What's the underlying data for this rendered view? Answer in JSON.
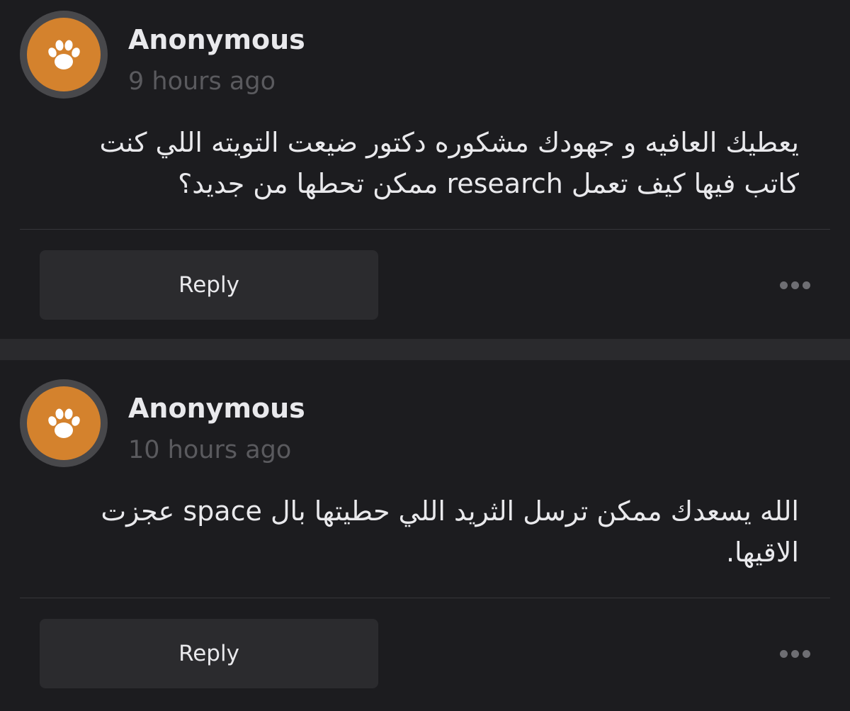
{
  "comments": [
    {
      "author": "Anonymous",
      "time": "9 hours ago",
      "message_lines": [
        "يعطيك العافيه و جهودك مشكوره دكتور ضيعت التويته اللي كنت",
        "كاتب فيها كيف تعمل research ممكن تحطها من جديد؟"
      ],
      "reply_label": "Reply",
      "avatar_icon": "paw-icon",
      "more_icon": "ellipsis-icon"
    },
    {
      "author": "Anonymous",
      "time": "10 hours ago",
      "message_lines": [
        "الله يسعدك ممكن ترسل الثريد اللي حطيتها بال space  عجزت",
        "الاقيها."
      ],
      "reply_label": "Reply",
      "avatar_icon": "paw-icon",
      "more_icon": "ellipsis-icon"
    }
  ],
  "colors": {
    "background": "#1c1c1f",
    "separator": "#2a2a2d",
    "avatar_ring": "#48484b",
    "avatar_fill": "#d4822d",
    "muted_text": "#5a5a5e",
    "button_bg": "#2b2b2e"
  }
}
